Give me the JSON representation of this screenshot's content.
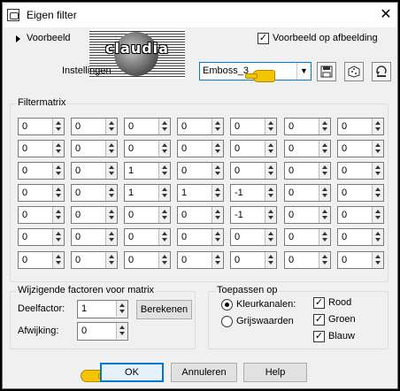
{
  "window": {
    "title": "Eigen filter",
    "close_symbol": "✕"
  },
  "preview": {
    "label": "Voorbeeld",
    "checkbox_label": "Voorbeeld op afbeelding",
    "checked": true
  },
  "logo": {
    "text": "claudia"
  },
  "settings": {
    "label": "Instellingen",
    "preset_value": "Emboss_3"
  },
  "toolbar": {
    "save_icon": "save-icon",
    "dice_icon": "dice-icon",
    "reset_icon": "reset-icon"
  },
  "matrix": {
    "label": "Filtermatrix",
    "rows": [
      [
        "0",
        "0",
        "0",
        "0",
        "0",
        "0",
        "0"
      ],
      [
        "0",
        "0",
        "0",
        "0",
        "0",
        "0",
        "0"
      ],
      [
        "0",
        "0",
        "1",
        "0",
        "0",
        "0",
        "0"
      ],
      [
        "0",
        "0",
        "1",
        "1",
        "-1",
        "0",
        "0"
      ],
      [
        "0",
        "0",
        "0",
        "0",
        "-1",
        "0",
        "0"
      ],
      [
        "0",
        "0",
        "0",
        "0",
        "0",
        "0",
        "0"
      ],
      [
        "0",
        "0",
        "0",
        "0",
        "0",
        "0",
        "0"
      ]
    ]
  },
  "factors": {
    "label": "Wijzigende factoren voor matrix",
    "divisor_label": "Deelfactor:",
    "divisor_value": "1",
    "calculate_label": "Berekenen",
    "bias_label": "Afwijking:",
    "bias_value": "0"
  },
  "apply": {
    "label": "Toepassen op",
    "color_channels_label": "Kleurkanalen:",
    "grayscale_label": "Grijswaarden",
    "selected": "color_channels",
    "red_label": "Rood",
    "green_label": "Groen",
    "blue_label": "Blauw",
    "red_checked": true,
    "green_checked": true,
    "blue_checked": true
  },
  "buttons": {
    "ok": "OK",
    "cancel": "Annuleren",
    "help": "Help"
  },
  "colors": {
    "accent": "#0078d7",
    "background": "#f0f0f0",
    "pointer": "#f5c400"
  }
}
